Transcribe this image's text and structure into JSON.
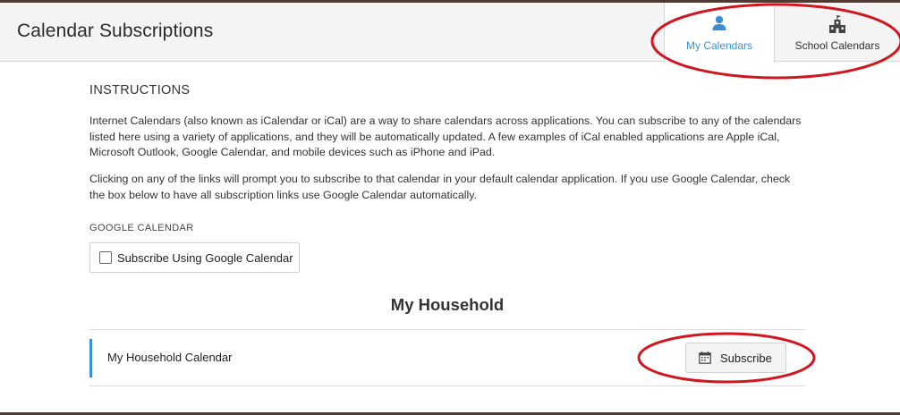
{
  "header": {
    "title": "Calendar Subscriptions",
    "tabs": [
      {
        "label": "My Calendars",
        "icon": "person-icon",
        "active": true,
        "color": "#3a8fd6"
      },
      {
        "label": "School Calendars",
        "icon": "school-building-icon",
        "active": false
      }
    ]
  },
  "instructions": {
    "heading": "INSTRUCTIONS",
    "paragraph1": "Internet Calendars (also known as iCalendar or iCal) are a way to share calendars across applications. You can subscribe to any of the calendars listed here using a variety of applications, and they will be automatically updated. A few examples of iCal enabled applications are Apple iCal, Microsoft Outlook, Google Calendar, and mobile devices such as iPhone and iPad.",
    "paragraph2": "Clicking on any of the links will prompt you to subscribe to that calendar in your default calendar application. If you use Google Calendar, check the box below to have all subscription links use Google Calendar automatically."
  },
  "google_calendar": {
    "heading": "GOOGLE CALENDAR",
    "checkbox_label": "Subscribe Using Google Calendar",
    "checked": false
  },
  "household": {
    "heading": "My Household",
    "calendar_name": "My Household Calendar",
    "subscribe_label": "Subscribe"
  },
  "colors": {
    "accent": "#3a8fd6",
    "annotation": "#d0161e",
    "frame": "#4e3a33"
  }
}
